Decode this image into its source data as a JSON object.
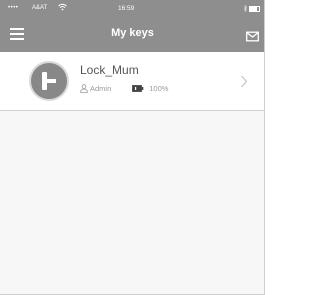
{
  "status_bar": {
    "signal": "••••",
    "carrier": "A&AT",
    "time": "16:59",
    "bluetooth": "∦"
  },
  "header": {
    "title": "My keys",
    "menu_icon": "hamburger-menu-icon",
    "mail_icon": "mail-icon",
    "bg_color": "#8e8e8e"
  },
  "keys": [
    {
      "name": "Lock_Mum",
      "role": "Admin",
      "battery": "100%",
      "battery_level": 1.0,
      "icon": "lock-icon"
    }
  ]
}
